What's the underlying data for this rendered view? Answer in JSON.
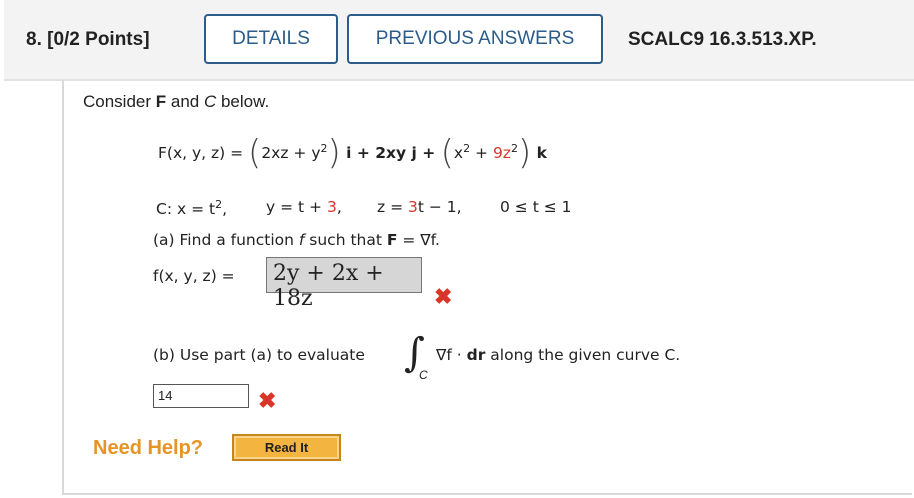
{
  "header": {
    "question": "8.  [0/2 Points]",
    "details_label": "DETAILS",
    "previous_answers_label": "PREVIOUS ANSWERS",
    "code": "SCALC9 16.3.513.XP."
  },
  "problem": {
    "intro_prefix": "Consider ",
    "intro_F": "F",
    "intro_mid": " and ",
    "intro_C": "C",
    "intro_suffix": " below.",
    "field_lhs": "F(x, y, z) = ",
    "field_term1_a": "2xz + y",
    "field_exp2": "2",
    "field_i": " i + 2xy j + ",
    "field_term3_a": "x",
    "field_term3_b": " + ",
    "field_term3_c": "9z",
    "field_k": " k",
    "curve_prefix": "C: x = t",
    "curve_y": "y = t + ",
    "curve_y_const": "3",
    "curve_z": "z = ",
    "curve_z_coef": "3",
    "curve_z_rest": "t − 1,",
    "curve_range": "0 ≤ t ≤ 1",
    "part_a_prefix": "(a) Find a function ",
    "part_a_f": "f",
    "part_a_mid": " such that ",
    "part_a_F": "F",
    "part_a_suffix": " = ∇f.",
    "part_a_lhs": "f(x, y, z) = ",
    "part_a_answer": "2y + 2x + 18z",
    "part_b_prefix": "(b) Use part (a) to evaluate",
    "part_b_integrand_a": "∇f · ",
    "part_b_integrand_dr": "dr",
    "part_b_suffix": " along the given curve C.",
    "integral_sub": "C",
    "part_b_answer": "14"
  },
  "help": {
    "need_help": "Need Help?",
    "read_it": "Read It"
  },
  "icons": {
    "wrong": "x-mark-icon"
  },
  "colors": {
    "accent": "#2b5c8a",
    "wrong": "#d9352b",
    "help": "#e69426",
    "button": "#f3b53f"
  }
}
